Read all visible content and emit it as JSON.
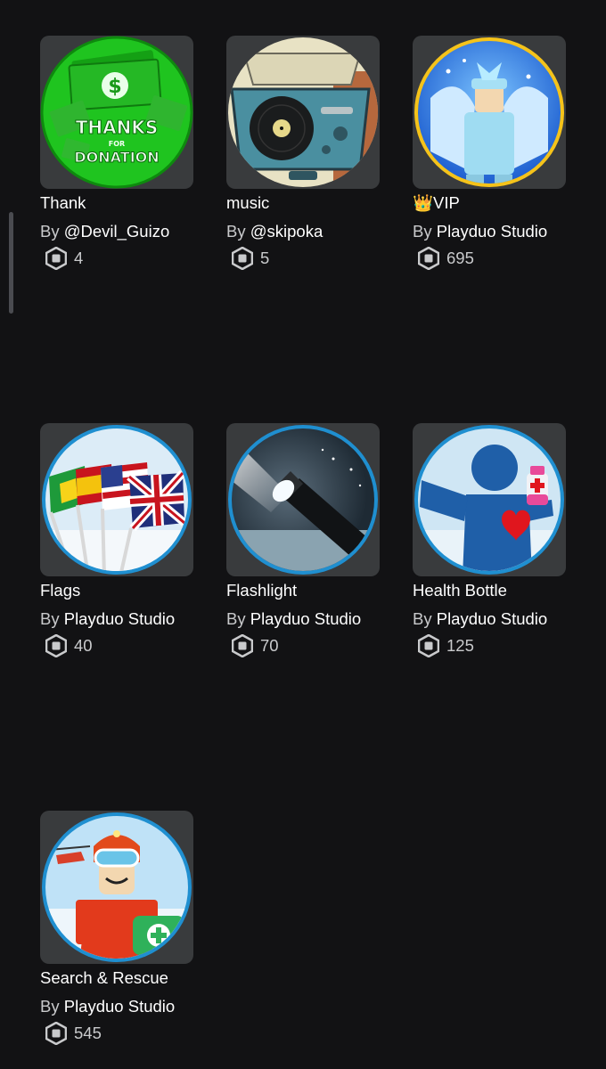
{
  "currency_icon": "robux-icon",
  "items": [
    {
      "name": "Thank",
      "by": "By",
      "creator": "@Devil_Guizo",
      "price": "4",
      "image": "thanks-for-donation-icon"
    },
    {
      "name": "music",
      "by": "By",
      "creator": "@skipoka",
      "price": "5",
      "image": "record-player-icon"
    },
    {
      "name": "👑VIP",
      "by": "By",
      "creator": "Playduo Studio",
      "price": "695",
      "image": "vip-avatar-icon"
    },
    {
      "name": "Flags",
      "by": "By",
      "creator": "Playduo Studio",
      "price": "40",
      "image": "flags-icon"
    },
    {
      "name": "Flashlight",
      "by": "By",
      "creator": "Playduo Studio",
      "price": "70",
      "image": "flashlight-icon"
    },
    {
      "name": "Health Bottle",
      "by": "By",
      "creator": "Playduo Studio",
      "price": "125",
      "image": "health-bottle-icon"
    },
    {
      "name": "Search & Rescue",
      "by": "By",
      "creator": "Playduo Studio",
      "price": "545",
      "image": "rescue-avatar-icon"
    }
  ],
  "thanks_image_text": {
    "line1": "THANKS",
    "line2": "FOR",
    "line3": "DONATION",
    "symbol": "$"
  }
}
